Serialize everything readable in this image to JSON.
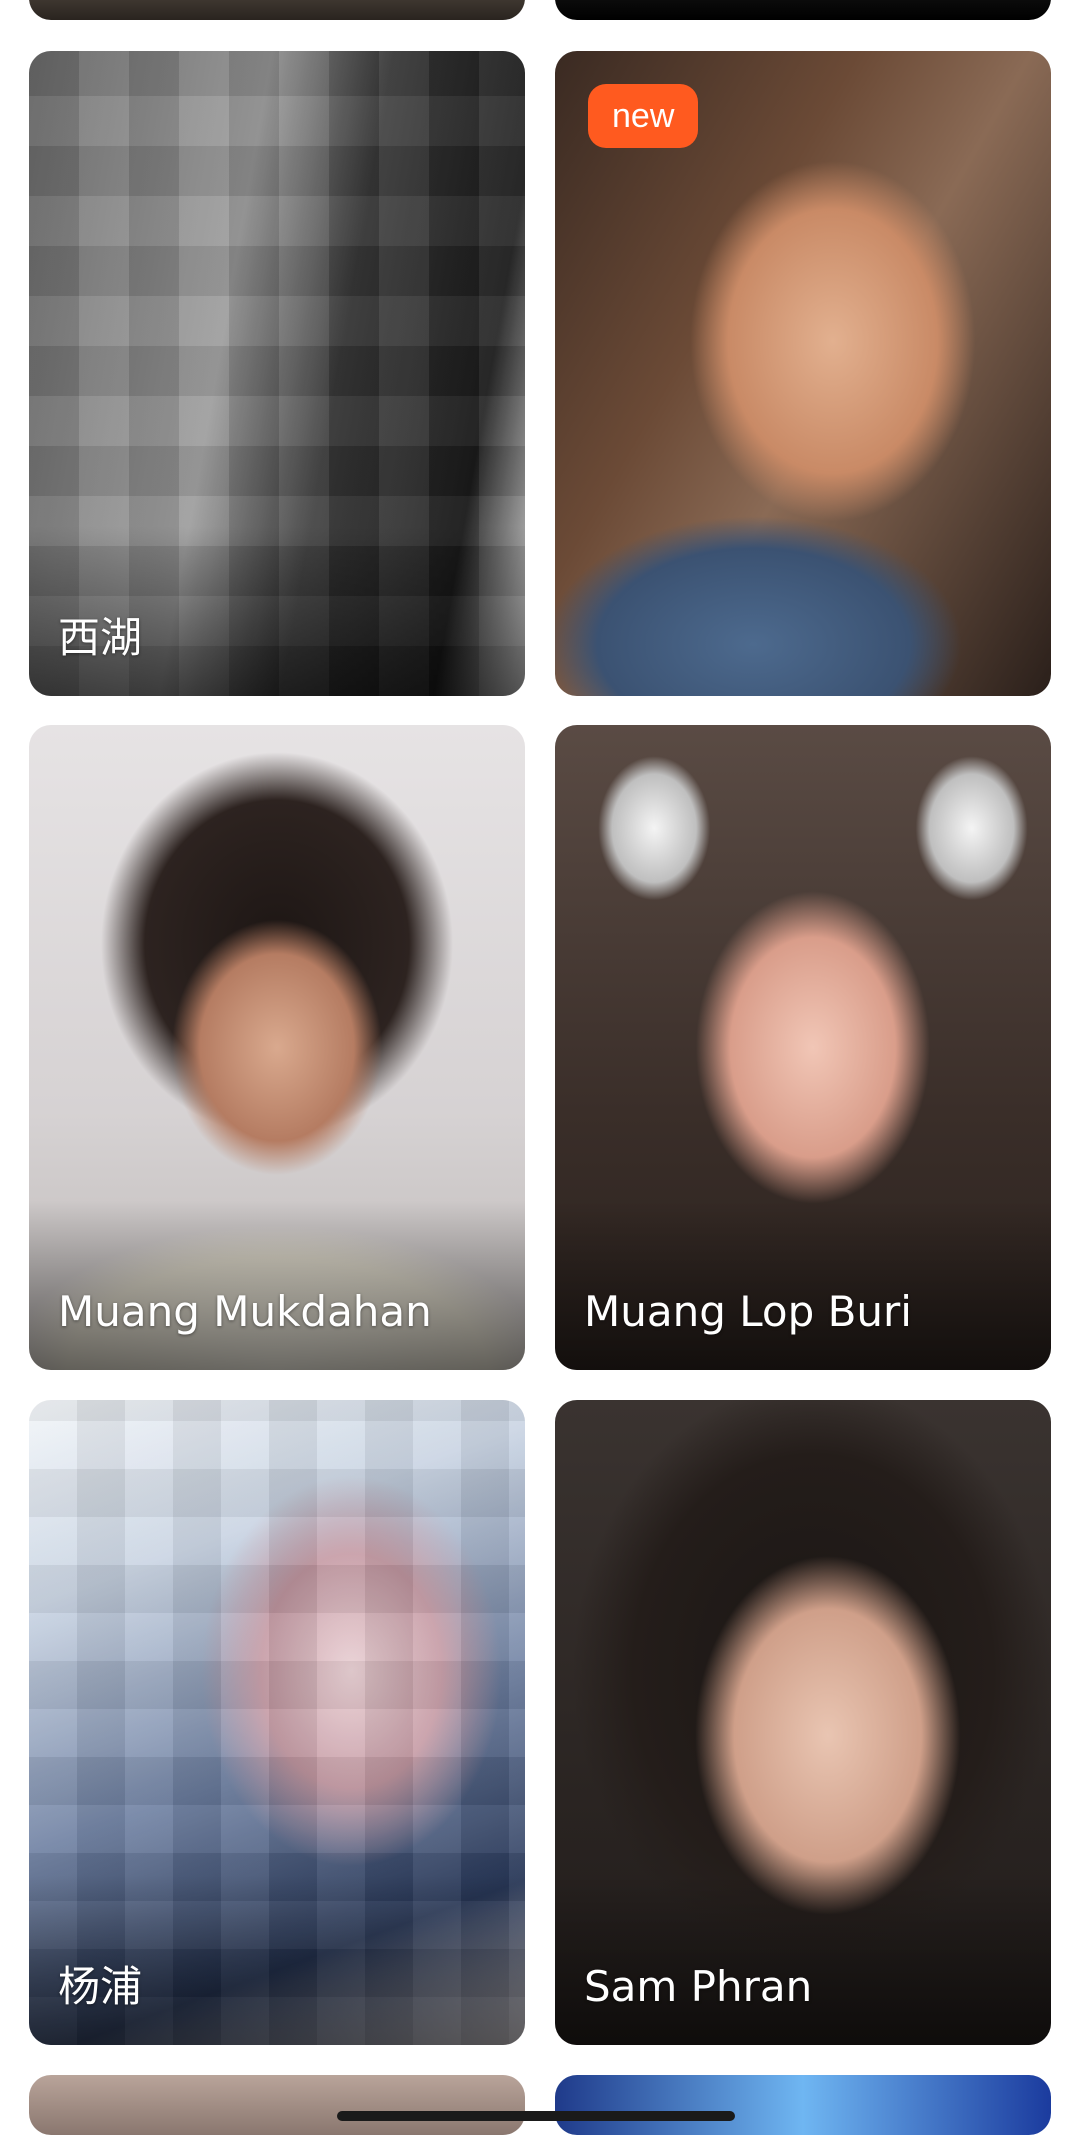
{
  "feed": {
    "cards": [
      {
        "name": "西湖",
        "badge": null,
        "photo": "mosaic-blurred-photo"
      },
      {
        "name": "",
        "badge": "new",
        "photo": "woman-selfie"
      },
      {
        "name": "Muang Mukdahan",
        "badge": null,
        "photo": "woman-with-glasses"
      },
      {
        "name": "Muang Lop Buri",
        "badge": null,
        "photo": "woman-dog-filter"
      },
      {
        "name": "杨浦",
        "badge": null,
        "photo": "mosaic-blurred-photo"
      },
      {
        "name": "Sam Phran",
        "badge": null,
        "photo": "woman-portrait"
      }
    ]
  },
  "colors": {
    "badge_bg": "#ff5a1f",
    "text_on_photo": "#ffffff",
    "background": "#ffffff"
  }
}
